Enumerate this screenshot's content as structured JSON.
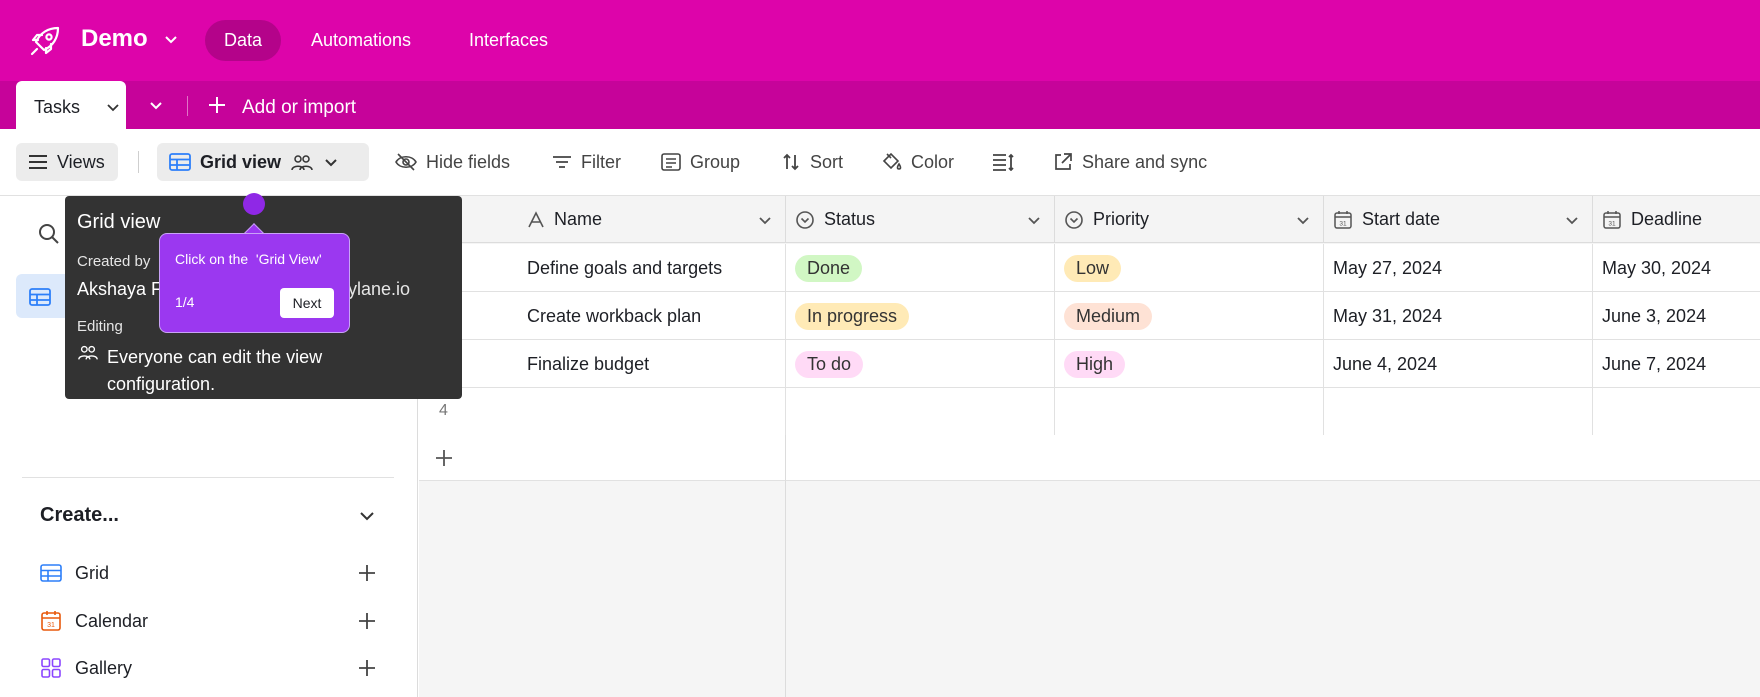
{
  "header": {
    "base_name": "Demo",
    "nav": [
      {
        "label": "Data",
        "active": true
      },
      {
        "label": "Automations",
        "active": false
      },
      {
        "label": "Interfaces",
        "active": false
      }
    ],
    "brand_color": "#dd04aa"
  },
  "tables": {
    "active_table": "Tasks",
    "add_or_import": "Add or import"
  },
  "toolbar": {
    "views_label": "Views",
    "current_view": "Grid view",
    "hide_fields": "Hide fields",
    "filter": "Filter",
    "group": "Group",
    "sort": "Sort",
    "color": "Color",
    "share_and_sync": "Share and sync"
  },
  "sidebar": {
    "create_heading": "Create...",
    "create_items": [
      {
        "label": "Grid",
        "icon": "grid-icon"
      },
      {
        "label": "Calendar",
        "icon": "calendar-icon"
      },
      {
        "label": "Gallery",
        "icon": "gallery-icon"
      }
    ]
  },
  "grid": {
    "columns": [
      {
        "label": "Name",
        "icon": "text-field-icon"
      },
      {
        "label": "Status",
        "icon": "single-select-icon"
      },
      {
        "label": "Priority",
        "icon": "single-select-icon"
      },
      {
        "label": "Start date",
        "icon": "date-icon"
      },
      {
        "label": "Deadline",
        "icon": "date-icon"
      }
    ],
    "rows": [
      {
        "name": "Define goals and targets",
        "status": "Done",
        "status_color": "#d1f7c4",
        "priority": "Low",
        "priority_color": "#ffeab6",
        "start": "May 27, 2024",
        "deadline": "May 30, 2024"
      },
      {
        "name": "Create workback plan",
        "status": "In progress",
        "status_color": "#ffeab6",
        "priority": "Medium",
        "priority_color": "#fee2d5",
        "start": "May 31, 2024",
        "deadline": "June 3, 2024"
      },
      {
        "name": "Finalize budget",
        "status": "To do",
        "status_color": "#ffdaf6",
        "priority": "High",
        "priority_color": "#ffdaf6",
        "start": "June 4, 2024",
        "deadline": "June 7, 2024"
      }
    ],
    "empty_row_number": "4"
  },
  "popover": {
    "title": "Grid view",
    "created_by_label": "Created by",
    "created_by_name": "Akshaya F",
    "created_by_tail": "ylane.io",
    "editing_label": "Editing",
    "editing_text": "Everyone can edit the view configuration."
  },
  "tour": {
    "text": "Click on the  'Grid View'",
    "step": "1/4",
    "next_label": "Next",
    "accent_color": "#9b38f0"
  }
}
